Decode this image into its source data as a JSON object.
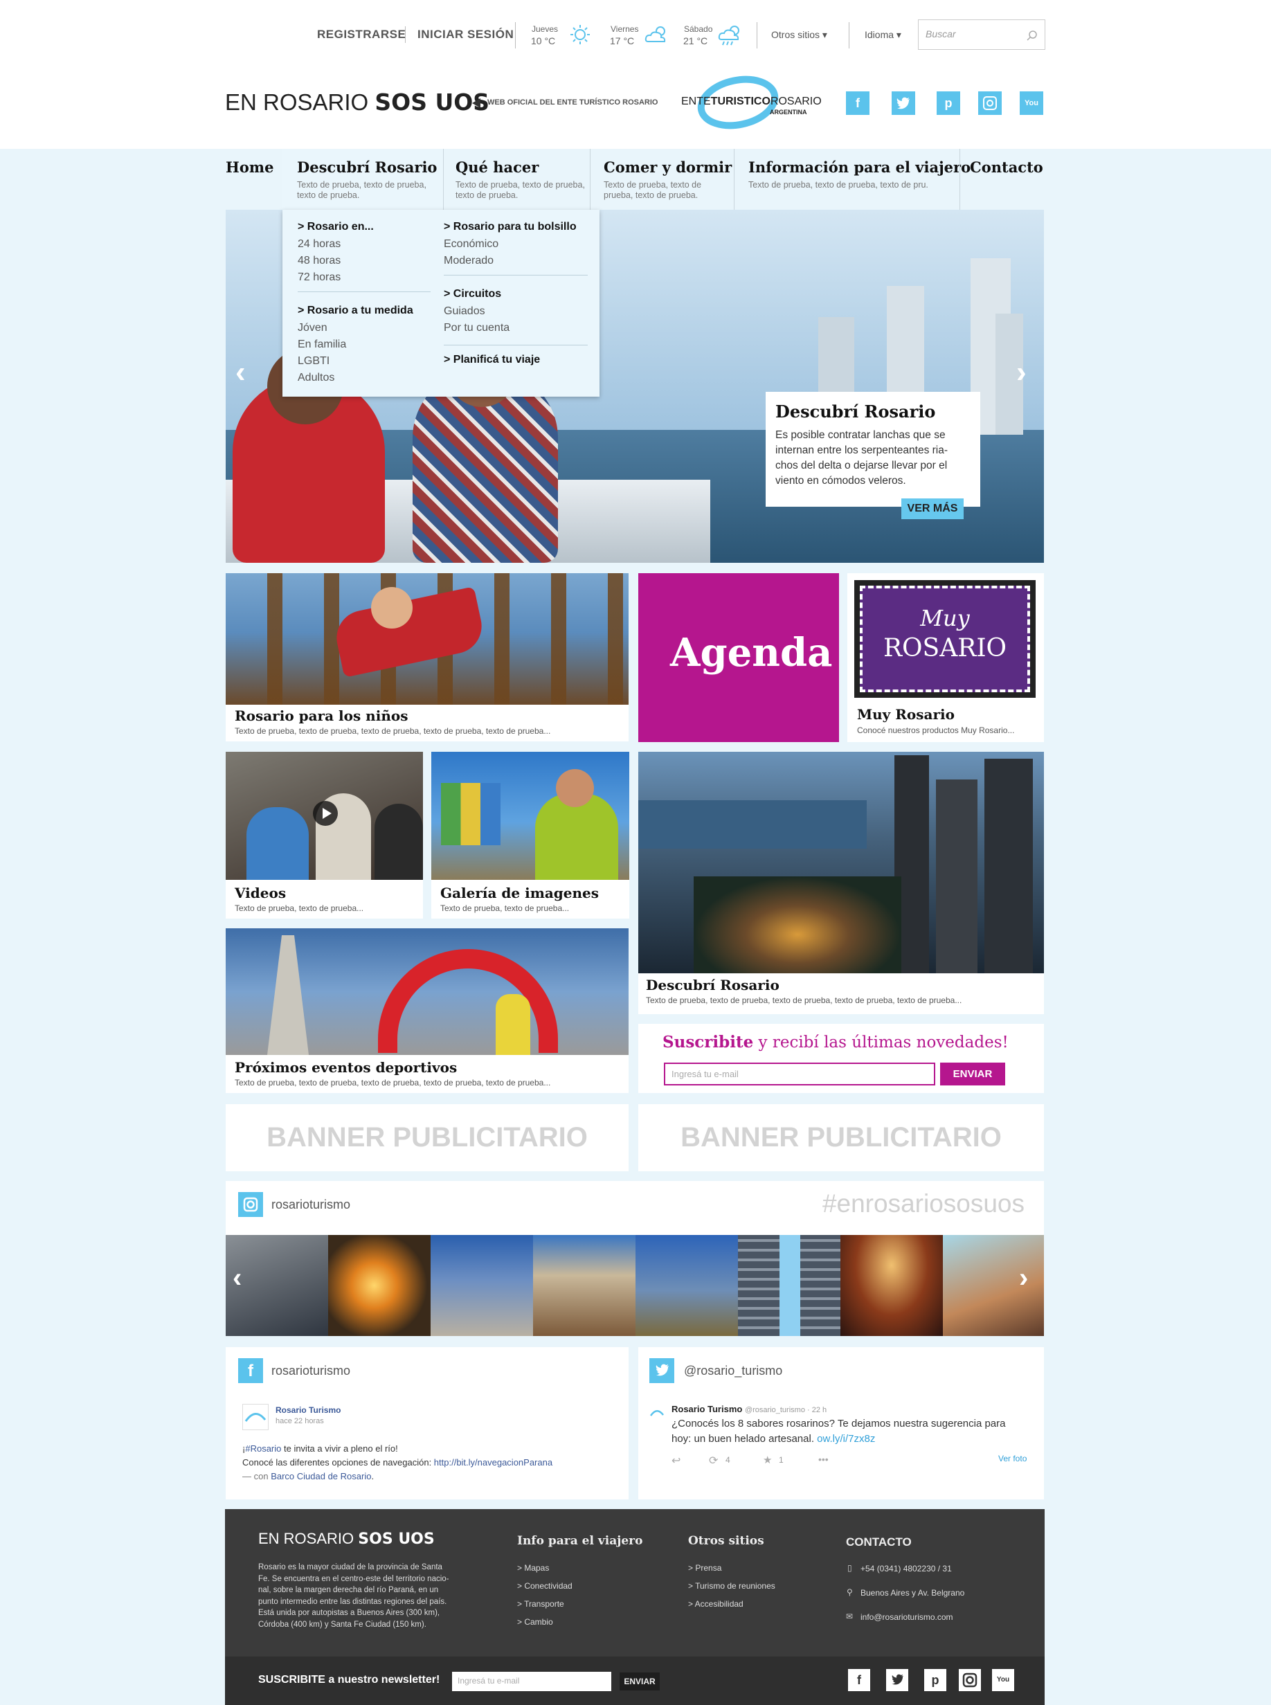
{
  "topbar": {
    "register": "REGISTRARSE",
    "login": "INICIAR SESIÓN",
    "weather": [
      {
        "day": "Jueves",
        "temp": "10 °C",
        "icon": "sun-icon"
      },
      {
        "day": "Viernes",
        "temp": "17 °C",
        "icon": "cloud-sun-icon"
      },
      {
        "day": "Sábado",
        "temp": "21 °C",
        "icon": "rain-sun-icon"
      }
    ],
    "other_sites": "Otros sitios",
    "language": "Idioma",
    "search_placeholder": "Buscar"
  },
  "header": {
    "brand_a": "EN ROSARIO",
    "brand_b": "SOS UOS",
    "tagline": "WEB OFICIAL DEL ENTE TURÍSTICO ROSARIO",
    "logo_a": "ENTE",
    "logo_b": "TURISTICO",
    "logo_c": "ROSARIO",
    "logo_d": "ARGENTINA",
    "social": [
      "facebook-icon",
      "twitter-icon",
      "pinterest-icon",
      "instagram-icon",
      "youtube-icon"
    ]
  },
  "nav": [
    {
      "title": "Home",
      "desc": ""
    },
    {
      "title": "Descubrí Rosario",
      "desc": "Texto de prueba, texto de prueba, texto de prueba."
    },
    {
      "title": "Qué hacer",
      "desc": "Texto de prueba, texto de prueba, texto de prueba."
    },
    {
      "title": "Comer y dormir",
      "desc": "Texto de prueba, texto de prueba, texto de prueba."
    },
    {
      "title": "Información para el viajero",
      "desc": "Texto de prueba, texto de prueba, texto de pru."
    },
    {
      "title": "Contacto",
      "desc": ""
    }
  ],
  "dropdown": {
    "col1": [
      {
        "head": "> Rosario en...",
        "items": [
          "24 horas",
          "48 horas",
          "72 horas"
        ]
      },
      {
        "head": "> Rosario a tu medida",
        "items": [
          "Jóven",
          "En familia",
          "LGBTI",
          "Adultos"
        ]
      }
    ],
    "col2": [
      {
        "head": "> Rosario para tu bolsillo",
        "items": [
          "Económico",
          "Moderado"
        ]
      },
      {
        "head": "> Circuitos",
        "items": [
          "Guiados",
          "Por tu cuenta"
        ]
      },
      {
        "head": "> Planificá tu viaje",
        "items": []
      }
    ]
  },
  "hero": {
    "title": "Descubrí Rosario",
    "text": "Es posible contratar lanchas que se internan entre los serpenteantes ria- chos del delta o dejarse llevar por el viento en cómodos veleros.",
    "button": "VER MÁS"
  },
  "tiles": {
    "ninos": {
      "title": "Rosario para los niños",
      "desc": "Texto de prueba, texto de prueba, texto de prueba, texto de prueba, texto de prueba..."
    },
    "agenda": {
      "title": "Agenda"
    },
    "muy": {
      "logo_a": "Muy",
      "logo_b": "Rosario",
      "title": "Muy Rosario",
      "desc": "Conocé nuestros productos Muy Rosario..."
    },
    "videos": {
      "title": "Videos",
      "desc": "Texto de prueba, texto de prueba..."
    },
    "galeria": {
      "title": "Galería de imagenes",
      "desc": "Texto de prueba, texto de prueba..."
    },
    "descubri": {
      "title": "Descubrí Rosario",
      "desc": "Texto de prueba, texto de prueba, texto de prueba, texto de prueba, texto de prueba..."
    },
    "eventos": {
      "title": "Próximos eventos deportivos",
      "desc": "Texto de prueba, texto de prueba, texto de prueba, texto de prueba, texto de prueba..."
    }
  },
  "subscribe": {
    "bold": "Suscribite",
    "rest": " y recibí las últimas novedades!",
    "placeholder": "Ingresá tu e-mail",
    "button": "ENVIAR"
  },
  "banners": [
    "BANNER PUBLICITARIO",
    "BANNER PUBLICITARIO"
  ],
  "instagram": {
    "user": "rosarioturismo",
    "hashtag": "#enrosariososuos"
  },
  "facebook": {
    "user": "rosarioturismo",
    "page": "Rosario Turismo",
    "time": "hace 22 horas",
    "l1a": "¡",
    "l1b": "#Rosario",
    "l1c": " te invita a vivir a pleno el río!",
    "l2a": "Conocé las diferentes opciones de navegación: ",
    "l2b": "http://bit.ly/navegacionParana",
    "l3a": "— con ",
    "l3b": "Barco Ciudad de Rosario",
    "l3c": "."
  },
  "twitter": {
    "user": "@rosario_turismo",
    "name": "Rosario Turismo",
    "handle": "@rosario_turismo · 22 h",
    "text1": "¿Conocés los 8 sabores rosarinos? Te dejamos nuestra sugerencia para",
    "text2": "hoy: un buen helado artesanal. ",
    "link": "ow.ly/i/7zx8z",
    "retweets": "4",
    "favs": "1",
    "ver_foto": "Ver foto"
  },
  "footer": {
    "brand_a": "EN ROSARIO",
    "brand_b": "SOS UOS",
    "about": [
      "Rosario es la mayor ciudad de la provincia de Santa",
      "Fe. Se encuentra en el centro-este del territorio nacio-",
      "nal, sobre la margen derecha del río Paraná, en un",
      "punto intermedio entre las distintas regiones del país.",
      "Está unida por autopistas a Buenos Aires (300 km),",
      "Córdoba (400 km) y Santa Fe Ciudad (150 km)."
    ],
    "info_title": "Info para el viajero",
    "info_items": [
      "> Mapas",
      "> Conectividad",
      "> Transporte",
      "> Cambio"
    ],
    "otros_title": "Otros sitios",
    "otros_items": [
      "> Prensa",
      "> Turismo de reuniones",
      "> Accesibilidad"
    ],
    "contacto_title": "CONTACTO",
    "phone": "+54 (0341) 4802230 / 31",
    "address": "Buenos Aires y Av. Belgrano",
    "email": "info@rosarioturismo.com",
    "newsletter": "SUSCRIBITE a nuestro newsletter!",
    "news_placeholder": "Ingresá tu e-mail",
    "news_button": "ENVIAR"
  },
  "colors": {
    "accent": "#5bc3ec",
    "magenta": "#b5168e",
    "purple": "#5b2c83",
    "footer": "#3b3b3b"
  }
}
